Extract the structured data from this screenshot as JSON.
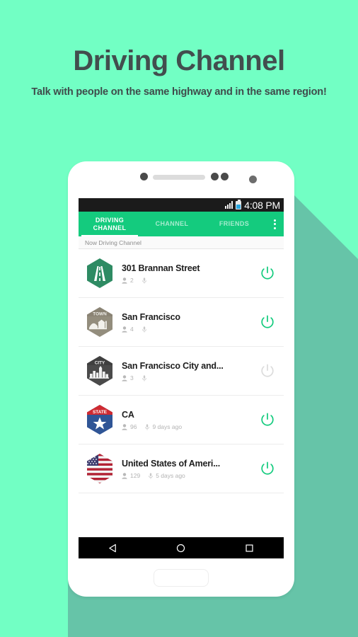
{
  "promo": {
    "title": "Driving Channel",
    "subtitle": "Talk with people on the same highway and in the same region!",
    "title_color": "#424e4e",
    "background_color": "#72ffc4",
    "shadow_color": "#66c4a8"
  },
  "status_bar": {
    "time": "4:08 PM",
    "signal_icon": "signal-bars-icon",
    "battery_icon": "battery-icon"
  },
  "app_bar": {
    "accent_color": "#14cb7e",
    "tabs": [
      {
        "label": "DRIVING CHANNEL",
        "active": true
      },
      {
        "label": "CHANNEL",
        "active": false
      },
      {
        "label": "FRIENDS",
        "active": false
      }
    ],
    "overflow_label": "more-options"
  },
  "section": {
    "header": "Now Driving Channel"
  },
  "channels": [
    {
      "name": "301 Brannan Street",
      "badge_type": "road",
      "badge_label": "",
      "badge_color": "#2e8b63",
      "people_count": "2",
      "time_ago": "",
      "power_on": true
    },
    {
      "name": "San Francisco",
      "badge_type": "town",
      "badge_label": "TOWN",
      "badge_color": "#938d7d",
      "people_count": "4",
      "time_ago": "",
      "power_on": true
    },
    {
      "name": "San Francisco City and...",
      "badge_type": "city",
      "badge_label": "CITY",
      "badge_color": "#4a4a4a",
      "people_count": "3",
      "time_ago": "",
      "power_on": false
    },
    {
      "name": "CA",
      "badge_type": "state",
      "badge_label": "STATE",
      "badge_color": "#2f5596",
      "people_count": "96",
      "time_ago": "9 days ago",
      "power_on": true
    },
    {
      "name": "United States of Ameri...",
      "badge_type": "flag",
      "badge_label": "",
      "badge_color": "#b22234",
      "people_count": "129",
      "time_ago": "5 days ago",
      "power_on": true
    }
  ],
  "nav_bar": {
    "back_icon": "back-triangle-icon",
    "home_icon": "home-circle-icon",
    "recents_icon": "recents-square-icon"
  },
  "phone": {
    "home_button_label": "home-button"
  }
}
